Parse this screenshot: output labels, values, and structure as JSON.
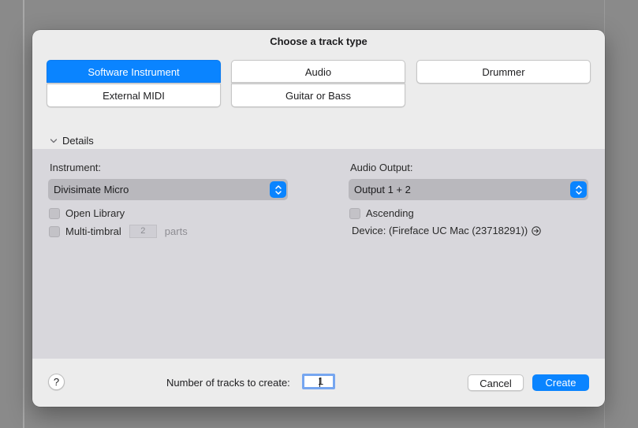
{
  "dialog": {
    "title": "Choose a track type"
  },
  "track_types": [
    {
      "label": "Software Instrument",
      "selected": true
    },
    {
      "label": "External MIDI",
      "selected": false
    },
    {
      "label": "Audio",
      "selected": false
    },
    {
      "label": "Guitar or Bass",
      "selected": false
    },
    {
      "label": "Drummer",
      "selected": false
    }
  ],
  "details": {
    "toggle_label": "Details",
    "expanded": true,
    "instrument": {
      "label": "Instrument:",
      "selected": "Divisimate Micro",
      "open_library_label": "Open Library",
      "open_library_checked": false,
      "multitimbral_label": "Multi-timbral",
      "multitimbral_checked": false,
      "parts_value": "2",
      "parts_label": "parts"
    },
    "audio_output": {
      "label": "Audio Output:",
      "selected": "Output 1 + 2",
      "ascending_label": "Ascending",
      "ascending_checked": false,
      "device_text": "Device: (Fireface UC Mac (23718291))"
    }
  },
  "footer": {
    "help_label": "?",
    "count_label": "Number of tracks to create:",
    "count_value": "1",
    "cancel_label": "Cancel",
    "create_label": "Create"
  },
  "colors": {
    "accent": "#0a84ff",
    "panel": "#d8d7dc",
    "dialog": "#ececec"
  }
}
